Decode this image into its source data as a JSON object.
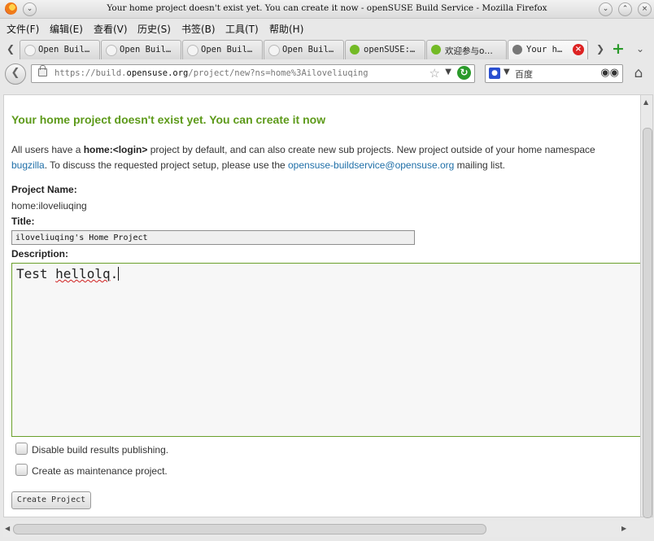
{
  "window": {
    "title": "Your home project doesn't exist yet. You can create it now - openSUSE Build Service - Mozilla Firefox"
  },
  "menu": [
    "文件(F)",
    "编辑(E)",
    "查看(V)",
    "历史(S)",
    "书签(B)",
    "工具(T)",
    "帮助(H)"
  ],
  "tabs": [
    {
      "label": "Open Buil…",
      "icon": "page-icon"
    },
    {
      "label": "Open Buil…",
      "icon": "page-icon"
    },
    {
      "label": "Open Buil…",
      "icon": "page-icon"
    },
    {
      "label": "Open Buil…",
      "icon": "page-icon"
    },
    {
      "label": "openSUSE:…",
      "icon": "opensuse-icon"
    },
    {
      "label": "欢迎参与o…",
      "icon": "opensuse-icon"
    },
    {
      "label": "Your h…",
      "icon": "page-icon",
      "active": true
    }
  ],
  "nav": {
    "url_prefix": "https://build.",
    "url_domain": "opensuse.org",
    "url_rest": "/project/new?ns=home%3Ailoveliuqing",
    "search_text": "百度"
  },
  "page": {
    "heading": "Your home project doesn't exist yet. You can create it now",
    "intro_1": "All users have a ",
    "intro_bold": "home:<login>",
    "intro_2": " project by default, and can also create new sub projects. New project outside of your home namespace",
    "intro_link1": "bugzilla",
    "intro_3": ". To discuss the requested project setup, please use the ",
    "intro_link2": "opensuse-buildservice@opensuse.org",
    "intro_4": " mailing list.",
    "project_name_label": "Project Name:",
    "project_name_value": "home:iloveliuqing",
    "title_label": "Title:",
    "title_value": "iloveliuqing's Home Project",
    "description_label": "Description:",
    "description_word1": "Test ",
    "description_word2": "hellolq",
    "description_word3": ".",
    "checkbox_disable_publish": "Disable build results publishing.",
    "checkbox_maintenance": "Create as maintenance project.",
    "submit_label": "Create Project"
  },
  "colors": {
    "heading": "#5d9a1a",
    "link": "#1f6fa8",
    "focus_border": "#6aa02a"
  }
}
